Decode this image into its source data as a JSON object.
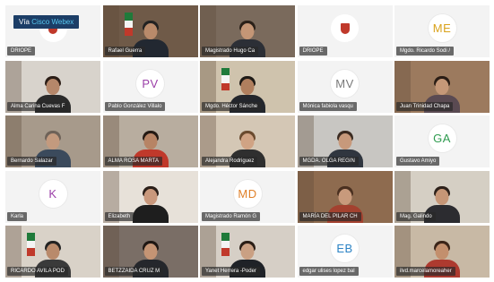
{
  "app": {
    "via_prefix": "Vía ",
    "brand": "Cisco Webex",
    "brand_color": "#56c7f0",
    "badge_bg": "#1c3e67"
  },
  "participants": [
    {
      "name": "DRIOPE",
      "type": "logo"
    },
    {
      "name": "Rafael Guerra",
      "type": "video",
      "bg": "#6f5a48",
      "shirt": "#222831",
      "skin": "#b98a6a",
      "hair": "#222",
      "flags": true
    },
    {
      "name": "Magistrado Hugo Ca",
      "type": "video",
      "bg": "#7a6a5c",
      "shirt": "#2c2f36",
      "skin": "#c49676",
      "hair": "#2a2018"
    },
    {
      "name": "DRIOPE",
      "type": "logo"
    },
    {
      "name": "Mgdo. Ricardo Sodi /",
      "type": "initials",
      "initials": "ME",
      "color": "#d9a21b"
    },
    {
      "name": "Alma Carina Cuevas F",
      "type": "video",
      "bg": "#d8d3cc",
      "shirt": "#2a2a2a",
      "skin": "#b5876a",
      "hair": "#2b1d16"
    },
    {
      "name": "Pablo González Villalo",
      "type": "initials",
      "initials": "PV",
      "color": "#9b3fa8"
    },
    {
      "name": "Mgdo. Héctor Sánche",
      "type": "video",
      "bg": "#cfc3ad",
      "shirt": "#23262c",
      "skin": "#b07f5e",
      "hair": "#1e1a16",
      "flags": true
    },
    {
      "name": "Mónica fabiola vasqu",
      "type": "initials",
      "initials": "MV",
      "color": "#7a7a7a"
    },
    {
      "name": "Juan Trinidad Chapa",
      "type": "video",
      "bg": "#9c7a5e",
      "shirt": "#5a4a52",
      "skin": "#c59878",
      "hair": "#2a1d15"
    },
    {
      "name": "Bernardo Salazar",
      "type": "video",
      "bg": "#a79a8b",
      "shirt": "#3b4a5c",
      "skin": "#c39a7e",
      "hair": "#6e6258"
    },
    {
      "name": "ALMA ROSA MARTA",
      "type": "video",
      "bg": "#b8ad9f",
      "shirt": "#c0392b",
      "skin": "#b78465",
      "hair": "#241a14"
    },
    {
      "name": "Alejandra Rodriguez",
      "type": "video",
      "bg": "#d4c7b5",
      "shirt": "#2f2f2f",
      "skin": "#d0a384",
      "hair": "#6a4a2e"
    },
    {
      "name": "MGDA. OLGA REGIN",
      "type": "video",
      "bg": "#c8c6c2",
      "shirt": "#30363f",
      "skin": "#c7997b",
      "hair": "#3a2a20"
    },
    {
      "name": "Gustavo Amiyo",
      "type": "initials",
      "initials": "GA",
      "color": "#2e9b4f"
    },
    {
      "name": "Karla",
      "type": "initials",
      "initials": "K",
      "color": "#9b3fa8"
    },
    {
      "name": "Elizabeth",
      "type": "video",
      "bg": "#e7e1d9",
      "shirt": "#1e1e1e",
      "skin": "#c9987c",
      "hair": "#2a1e18"
    },
    {
      "name": "Magistrado Ramón G",
      "type": "initials",
      "initials": "MD",
      "color": "#e0812a"
    },
    {
      "name": "MARÍA DEL PILAR CH",
      "type": "video",
      "bg": "#8e6b4f",
      "shirt": "#a3412f",
      "skin": "#c89a7c",
      "hair": "#4a3020"
    },
    {
      "name": "Mag. Galindo",
      "type": "video",
      "bg": "#d5cfc4",
      "shirt": "#2c2c30",
      "skin": "#c69676",
      "hair": "#2d211a"
    },
    {
      "name": "RICARDO AVILA POD",
      "type": "video",
      "bg": "#d9d2c8",
      "shirt": "#3a3a3a",
      "skin": "#b98a6b",
      "hair": "#222",
      "flags": true
    },
    {
      "name": "BETZZAIDA CRUZ M",
      "type": "video",
      "bg": "#7a6e66",
      "shirt": "#25272c",
      "skin": "#c49474",
      "hair": "#1e1713"
    },
    {
      "name": "Yanet Herrera -Poder",
      "type": "video",
      "bg": "#d6cfc6",
      "shirt": "#1f2227",
      "skin": "#caa083",
      "hair": "#2a1e16",
      "flags": true
    },
    {
      "name": "edgar ulises lopez bal",
      "type": "initials",
      "initials": "EB",
      "color": "#2c83c5"
    },
    {
      "name": "ilvd.marcelamoreaher",
      "type": "video",
      "bg": "#c8b9a5",
      "shirt": "#ad3a2f",
      "skin": "#c38f6d",
      "hair": "#3b2418"
    }
  ]
}
